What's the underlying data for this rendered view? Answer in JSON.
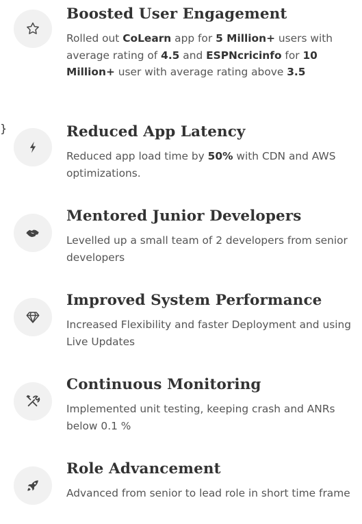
{
  "items": [
    {
      "icon": "star-outline-icon",
      "title": "Boosted User Engagement",
      "description": [
        {
          "t": "Rolled out "
        },
        {
          "t": "CoLearn",
          "b": true
        },
        {
          "t": " app for "
        },
        {
          "t": "5 Million+",
          "b": true
        },
        {
          "t": " users with average rating of "
        },
        {
          "t": "4.5",
          "b": true
        },
        {
          "t": " and "
        },
        {
          "t": "ESPNcricinfo",
          "b": true
        },
        {
          "t": " for "
        },
        {
          "t": "10 Million+",
          "b": true
        },
        {
          "t": " user with average rating above "
        },
        {
          "t": "3.5",
          "b": true
        }
      ]
    },
    {
      "icon": "lightning-bolt-icon",
      "title": "Reduced App Latency",
      "description": [
        {
          "t": "Reduced app load time by "
        },
        {
          "t": "50%",
          "b": true
        },
        {
          "t": " with CDN and AWS optimizations."
        }
      ]
    },
    {
      "icon": "handshake-icon",
      "title": "Mentored Junior Developers",
      "description": [
        {
          "t": "Levelled up a small team of 2 developers from senior developers"
        }
      ]
    },
    {
      "icon": "diamond-icon",
      "title": "Improved System Performance",
      "description": [
        {
          "t": "Increased Flexibility and faster Deployment and using Live Updates"
        }
      ]
    },
    {
      "icon": "tools-icon",
      "title": "Continuous Monitoring",
      "description": [
        {
          "t": "Implemented unit testing, keeping crash and ANRs below 0.1 %"
        }
      ]
    },
    {
      "icon": "rocket-icon",
      "title": "Role Advancement",
      "description": [
        {
          "t": "Advanced from senior to lead role in short time frame"
        }
      ]
    }
  ],
  "colors": {
    "icon_bg": "#f1f1f1",
    "icon_fg": "#444444",
    "title": "#333333",
    "text": "#555555"
  }
}
